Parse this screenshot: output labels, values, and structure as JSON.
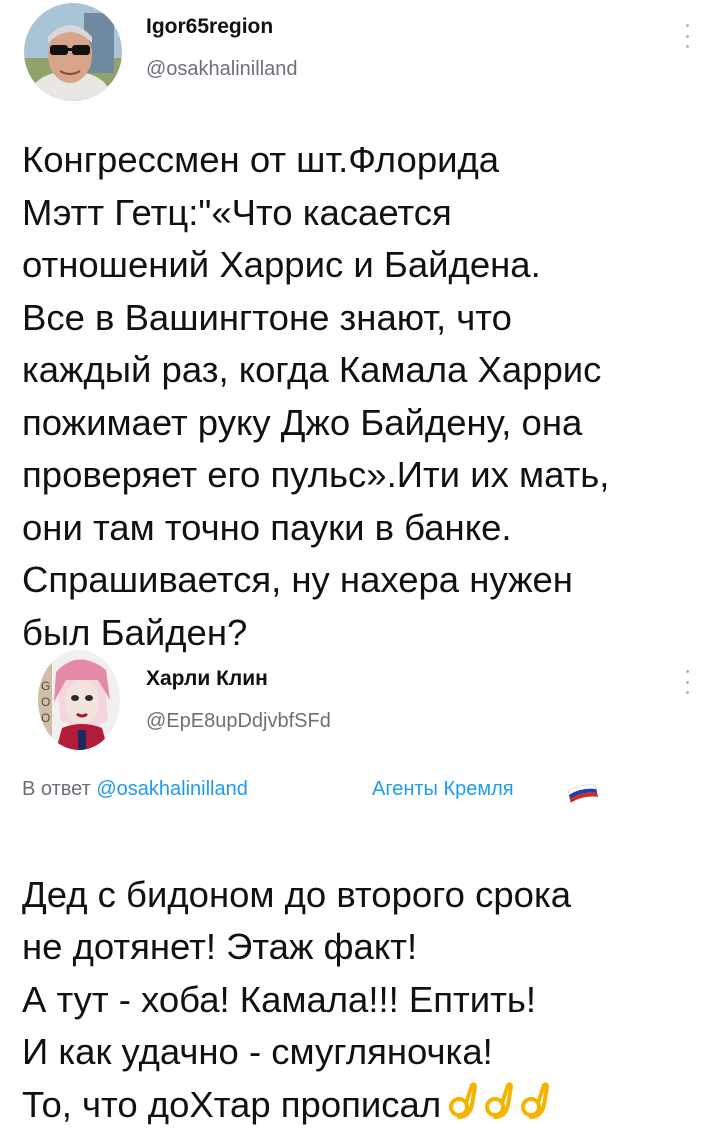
{
  "post1": {
    "author_name": "Igor65region",
    "author_handle": "@osakhalinilland",
    "text": "Конгрессмен от шт.Флорида\nМэтт Гетц:\"«Что касается\nотношений Харрис и Байдена.\nВсе в Вашингтоне знают, что\nкаждый раз, когда Камала Харрис\nпожимает руку Джо Байдену, она\nпроверяет его пульс».Ити их мать,\nони там точно пауки в банке.\nСпрашивается, ну нахера нужен\nбыл Байден?"
  },
  "post2": {
    "author_name": "Харли Клин",
    "author_handle": "@EpE8upDdjvbfSFd",
    "reply_prefix": "В ответ",
    "reply_to": "@osakhalinilland",
    "tag": "Агенты Кремля",
    "text": "Дед с бидоном до второго срока\nне дотянет! Этаж факт!\nА тут - хоба! Камала!!! Ептить!\nИ как удачно - смугляночка!\nТо, что доХтар прописал",
    "emoji": [
      "ok-hand-icon",
      "ok-hand-icon",
      "ok-hand-icon"
    ]
  },
  "colors": {
    "text": "#111111",
    "secondary": "#6b7178",
    "link": "#1d9bf0"
  }
}
